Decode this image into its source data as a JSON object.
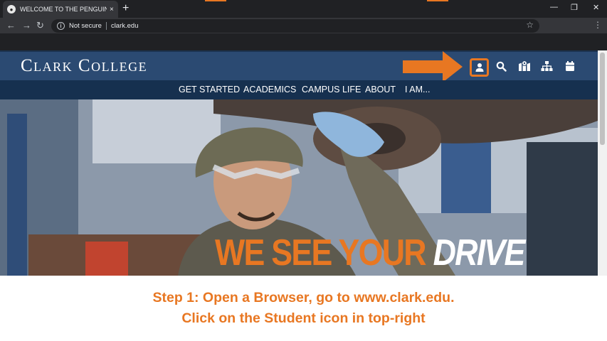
{
  "browser": {
    "tab_title": "WELCOME TO THE PENGUIN NATION",
    "tab_close": "×",
    "new_tab": "+",
    "security_label": "Not secure",
    "url": "clark.edu"
  },
  "site": {
    "logo": "Clark College",
    "nav": [
      "GET STARTED",
      "ACADEMICS",
      "CAMPUS LIFE",
      "ABOUT",
      "I AM..."
    ],
    "header_icons": [
      "student-icon",
      "search-icon",
      "map-icon",
      "sitemap-icon",
      "calendar-icon"
    ],
    "colors": {
      "header": "#2b4a72",
      "nav": "#16304f",
      "accent": "#e87722"
    }
  },
  "hero": {
    "headline_orange": "WE SEE YOUR",
    "headline_white": "DRIVE"
  },
  "caption": {
    "line1": "Step 1: Open a Browser, go to www.clark.edu.",
    "line2": "Click on the Student icon in top-right"
  }
}
